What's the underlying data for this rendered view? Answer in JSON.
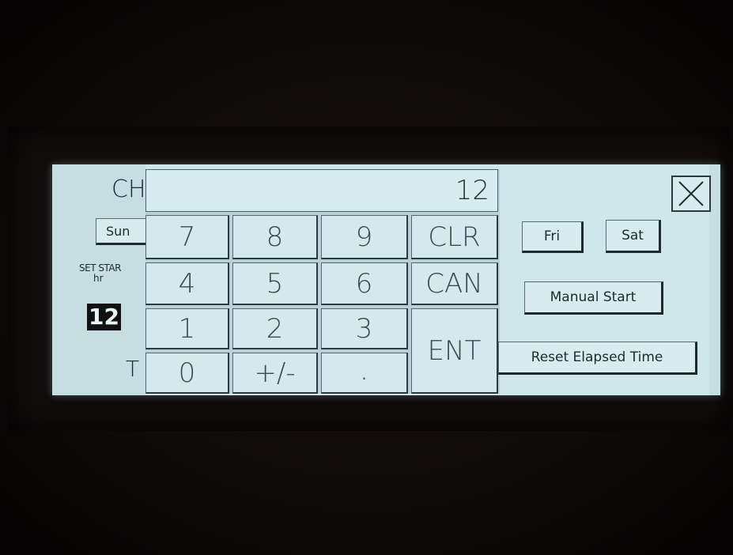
{
  "screen": {
    "bg_color": "#cfe6ea",
    "left_panel": {
      "title_fragment": "CH",
      "sunday_button": "Sun",
      "set_start_label": "SET STAR",
      "hour_unit_label": "hr",
      "hour_value": "12",
      "bottom_fragment": "T"
    },
    "keypad": {
      "display_value": "12",
      "keys": [
        "7",
        "8",
        "9",
        "CLR",
        "4",
        "5",
        "6",
        "CAN",
        "1",
        "2",
        "3",
        "ENT",
        "0",
        "+/-",
        "."
      ]
    },
    "right_panel": {
      "close_icon": "close-x-icon",
      "friday_button": "Fri",
      "saturday_button": "Sat",
      "manual_start_button": "Manual Start",
      "reset_elapsed_button": "Reset Elapsed Time"
    }
  }
}
